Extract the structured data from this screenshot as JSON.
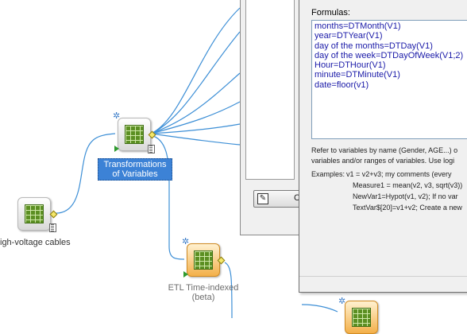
{
  "nodes": {
    "cables": {
      "label": "igh-voltage cables"
    },
    "transform": {
      "label": "Transformations of Variables"
    },
    "etl": {
      "label": "ETL Time-indexed (beta)"
    }
  },
  "back_dialog": {
    "button_label": "C"
  },
  "formula_dialog": {
    "formulas_label": "Formulas:",
    "formulas": [
      "months=DTMonth(V1)",
      "year=DTYear(V1)",
      "day of the months=DTDay(V1)",
      "day of the week=DTDayOfWeek(V1;2)",
      "Hour=DTHour(V1)",
      "minute=DTMinute(V1)",
      "date=floor(v1)"
    ],
    "help_line1": "Refer to variables by name (Gender, AGE...) o",
    "help_line2": "variables and/or ranges of variables.  Use logi",
    "examples_label": "Examples:",
    "examples": [
      "v1 = v2+v3; my comments (every",
      "Measure1 = mean(v2, v3, sqrt(v3))",
      "NewVar1=Hypot(v1, v2); If no var",
      "TextVar$[20]=v1+v2; Create a new"
    ]
  },
  "colors": {
    "connection": "#3d8fd6",
    "selection": "#3c82d6",
    "formula_text": "#1a1aa8"
  }
}
